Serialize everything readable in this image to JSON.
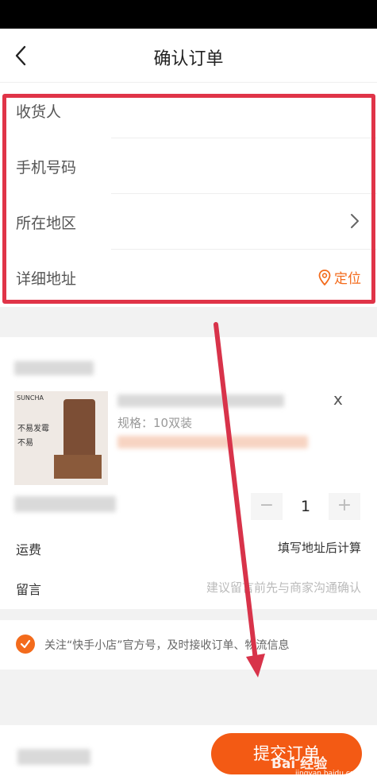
{
  "page": {
    "title": "确认订单"
  },
  "address_form": {
    "fields": [
      {
        "label": "收货人"
      },
      {
        "label": "手机号码"
      },
      {
        "label": "所在地区"
      },
      {
        "label": "详细地址"
      }
    ],
    "locate_label": "定位"
  },
  "product": {
    "image_brand": "SUNCHA",
    "image_caption_1": "不易发霉",
    "image_caption_2": "不易",
    "spec": "规格：10双装",
    "quantity_prefix": "x",
    "quantity": "1",
    "minus": "−",
    "plus": "+"
  },
  "shipping": {
    "label": "运费",
    "value": "填写地址后计算"
  },
  "message": {
    "label": "留言",
    "placeholder": "建议留言前先与商家沟通确认"
  },
  "follow": {
    "text": "关注“快手小店”官方号，及时接收订单、物流信息",
    "checked": true
  },
  "footer": {
    "submit_label": "提交订单"
  },
  "watermark": {
    "text": "Bai 经验",
    "url": "jingyan.baidu.com"
  },
  "colors": {
    "accent": "#f35a14",
    "highlight": "#e03448",
    "annotation_arrow": "#d8334a"
  }
}
